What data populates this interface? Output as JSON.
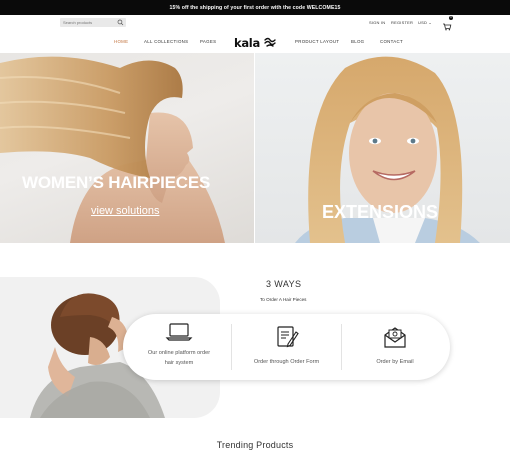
{
  "announcement": "15% off the shipping of your first order with the code WELCOME15",
  "search": {
    "placeholder": "Search products"
  },
  "top_links": {
    "sign_in": "SIGN IN",
    "register": "REGISTER",
    "currency": "USD ⌄"
  },
  "cart": {
    "count": "0"
  },
  "nav": {
    "items": [
      {
        "label": "HOME"
      },
      {
        "label": "ALL COLLECTIONS"
      },
      {
        "label": "PAGES"
      },
      {
        "label": "PRODUCT LAYOUT"
      },
      {
        "label": "BLOG"
      },
      {
        "label": "CONTACT"
      }
    ],
    "logo": "kala"
  },
  "hero": {
    "left_title": "WOMEN’S HAIRPIECES",
    "left_link": "view solutions",
    "right_title": "EXTENSIONS"
  },
  "ways": {
    "title": "3 WAYS",
    "subtitle": "To Order A Hair Pieces",
    "options": [
      {
        "label_line1": "Our online platform order",
        "label_line2": "hair system",
        "icon": "laptop-icon"
      },
      {
        "label_line1": "Order through Order Form",
        "label_line2": "",
        "icon": "order-form-icon"
      },
      {
        "label_line1": "Order by Email",
        "label_line2": "",
        "icon": "email-icon"
      }
    ]
  },
  "trending": {
    "title": "Trending Products"
  },
  "colors": {
    "accent": "#c0703a",
    "announcement_bg": "#0a0a0a"
  }
}
